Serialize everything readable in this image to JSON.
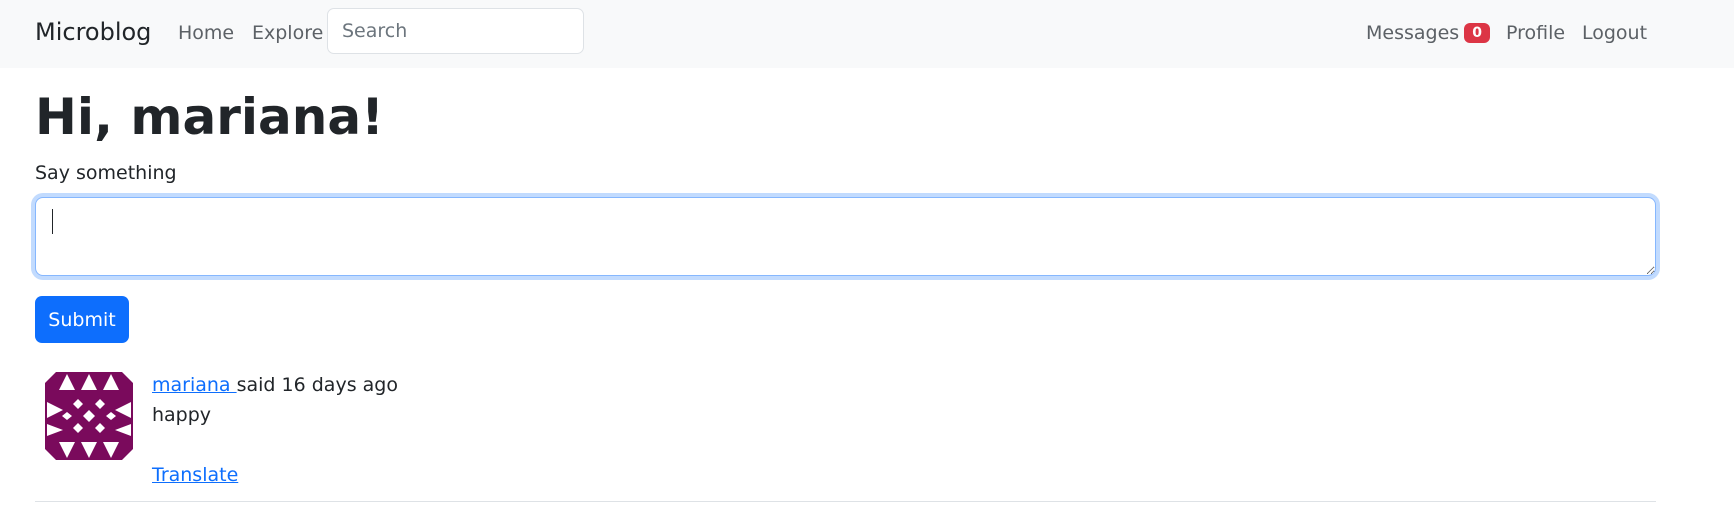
{
  "navbar": {
    "brand": "Microblog",
    "links": [
      "Home",
      "Explore"
    ],
    "search_placeholder": "Search",
    "right": {
      "messages_label": "Messages",
      "messages_count": "0",
      "profile_label": "Profile",
      "logout_label": "Logout"
    }
  },
  "main": {
    "greeting": "Hi, mariana!",
    "post_label": "Say something",
    "post_value": "",
    "submit_label": "Submit"
  },
  "posts": [
    {
      "author": "mariana",
      "said_text": "said 16 days ago",
      "body": "happy",
      "translate_label": "Translate",
      "avatar_color": "#7a0a5c"
    }
  ]
}
